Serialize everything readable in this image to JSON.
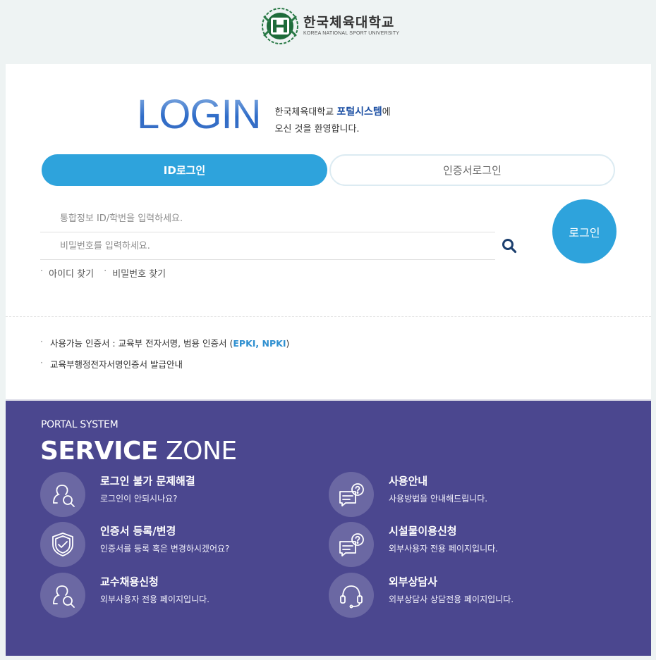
{
  "header": {
    "school_name_kr": "한국체육대학교",
    "school_name_en": "KOREA NATIONAL SPORT UNIVERSITY",
    "logo_icon": "university-emblem-icon"
  },
  "hero": {
    "login_word": "LOGIN",
    "welcome_prefix": "한국체육대학교 ",
    "welcome_highlight": "포털시스템",
    "welcome_suffix": "에",
    "welcome_line2": "오신 것을 환영합니다."
  },
  "tabs": {
    "id_login": "ID로그인",
    "cert_login": "인증서로그인"
  },
  "form": {
    "id_placeholder": "통합정보 ID/학번을 입력하세요.",
    "pw_placeholder": "비밀번호를 입력하세요.",
    "login_button": "로그인",
    "find_id": "아이디 찾기",
    "find_pw": "비밀번호 찾기",
    "bullet": "·"
  },
  "notices": {
    "line1_prefix": "사용가능 인증서 : 교육부 전자서명, 범용 인증서 (",
    "line1_highlight": "EPKI, NPKI",
    "line1_suffix": ")",
    "line2": "교육부행정전자서명인증서 발급안내"
  },
  "service": {
    "portal_label": "PORTAL SYSTEM",
    "title_bold": "SERVICE",
    "title_light": " ZONE",
    "items": [
      {
        "title": "로그인 불가 문제해결",
        "desc": "로그인이 안되시나요?",
        "icon": "user-search-icon"
      },
      {
        "title": "사용안내",
        "desc": "사용방법을 안내해드립니다.",
        "icon": "chat-question-icon"
      },
      {
        "title": "인증서 등록/변경",
        "desc": "인증서를 등록 혹은 변경하시겠어요?",
        "icon": "shield-check-icon"
      },
      {
        "title": "시설물이용신청",
        "desc": "외부사용자 전용 페이지입니다.",
        "icon": "chat-question-icon"
      },
      {
        "title": "교수채용신청",
        "desc": "외부사용자 전용 페이지입니다.",
        "icon": "user-search-icon"
      },
      {
        "title": "외부상담사",
        "desc": "외부상담사 상담전용 페이지입니다.",
        "icon": "headset-icon"
      }
    ]
  },
  "colors": {
    "accent": "#2ea3dc",
    "service_bg": "#4b478f",
    "brand_green": "#1e6b3a",
    "login_gradient_dark": "#2e6cc8"
  }
}
